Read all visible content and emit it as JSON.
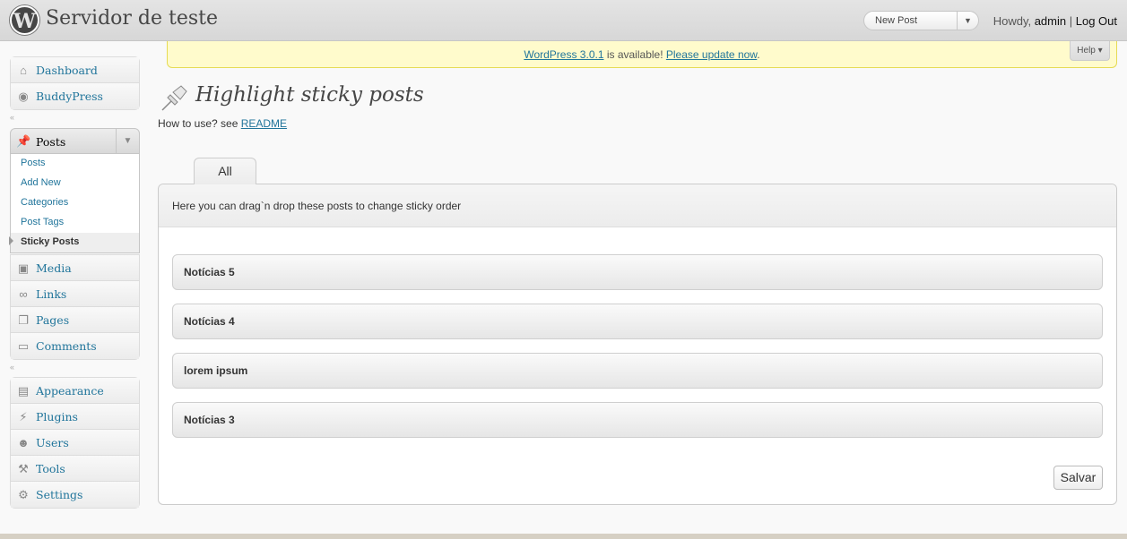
{
  "header": {
    "site_title": "Servidor de teste",
    "favorite_action": "New Post",
    "greeting": "Howdy, ",
    "username": "admin",
    "separator": " | ",
    "logout": "Log Out"
  },
  "sidebar": {
    "group1": [
      {
        "label": "Dashboard",
        "icon": "dashboard-icon"
      },
      {
        "label": "BuddyPress",
        "icon": "buddypress-icon"
      }
    ],
    "posts_menu": {
      "label": "Posts",
      "icon": "pushpin-icon",
      "submenu": [
        "Posts",
        "Add New",
        "Categories",
        "Post Tags",
        "Sticky Posts"
      ],
      "current": "Sticky Posts"
    },
    "group2": [
      {
        "label": "Media",
        "icon": "media-icon"
      },
      {
        "label": "Links",
        "icon": "links-icon"
      },
      {
        "label": "Pages",
        "icon": "pages-icon"
      },
      {
        "label": "Comments",
        "icon": "comments-icon"
      }
    ],
    "group3": [
      {
        "label": "Appearance",
        "icon": "appearance-icon"
      },
      {
        "label": "Plugins",
        "icon": "plugins-icon"
      },
      {
        "label": "Users",
        "icon": "users-icon"
      },
      {
        "label": "Tools",
        "icon": "tools-icon"
      },
      {
        "label": "Settings",
        "icon": "settings-icon"
      }
    ]
  },
  "notice": {
    "version_link": "WordPress 3.0.1",
    "middle_text": " is available! ",
    "update_link": "Please update now",
    "end_text": "."
  },
  "help": "Help",
  "main": {
    "title": "Highlight sticky posts",
    "howto_text": "How to use? see ",
    "readme_link": "README",
    "tab": "All",
    "instructions": "Here you can drag`n drop these posts to change sticky order",
    "posts": [
      "Notícias 5",
      "Notícias 4",
      "lorem ipsum",
      "Notícias 3"
    ],
    "save_label": "Salvar"
  },
  "colors": {
    "link": "#21759b",
    "notice_bg": "#fffbcc"
  }
}
